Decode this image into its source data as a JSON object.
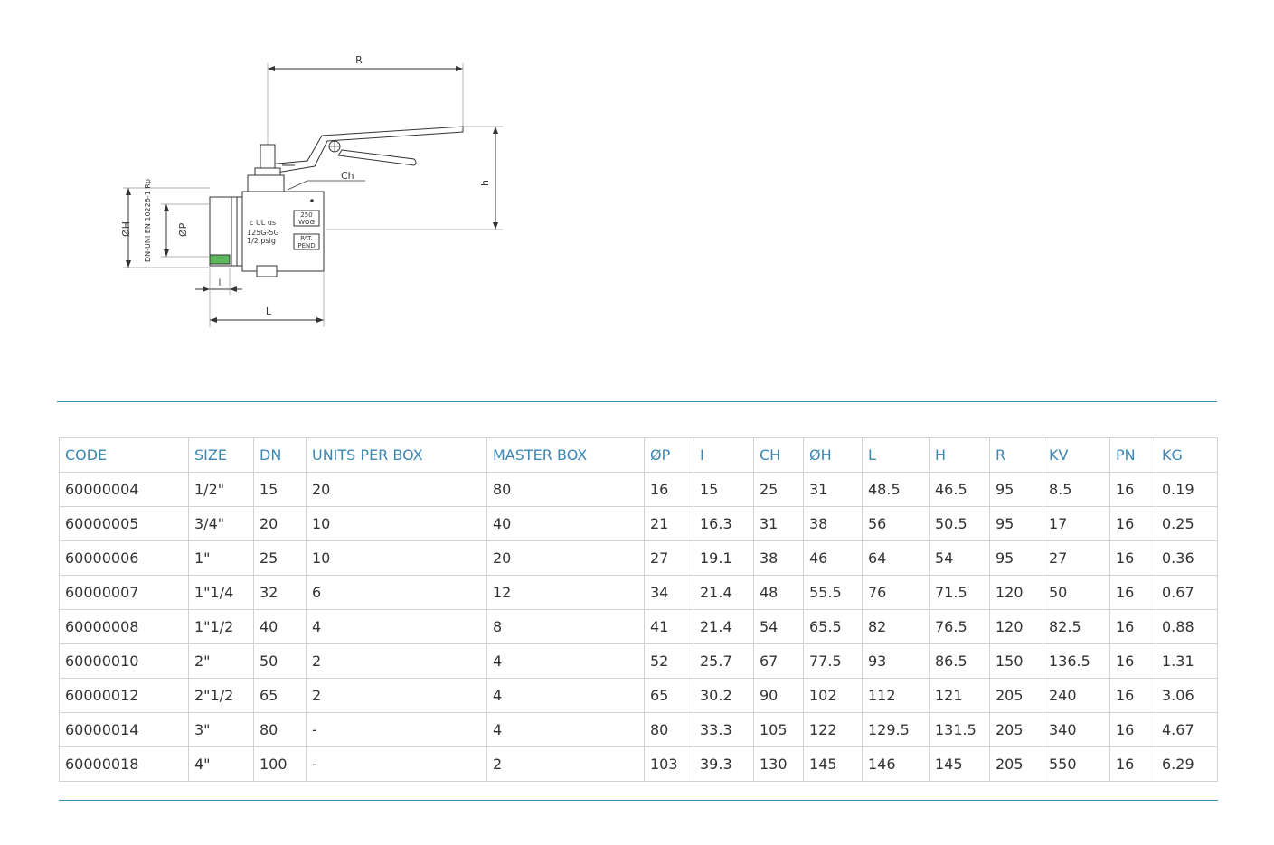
{
  "drawing": {
    "dim_R": "R",
    "dim_h": "h",
    "dim_Ch": "Ch",
    "dim_OH": "ØH",
    "dim_OP": "ØP",
    "dim_l": "l",
    "dim_L": "L",
    "standard_label": "DN-UNI EN 10226-1 Rp",
    "cert_mark": "c UL us",
    "body_text_1": "125G-5G",
    "body_text_2": "1/2 psig",
    "badge_wog_1": "250",
    "badge_wog_2": "WOG",
    "badge_pat_1": "PAT.",
    "badge_pat_2": "PEND"
  },
  "colors": {
    "accent": "#3a87b3",
    "green_ring": "#5cb85c"
  },
  "table": {
    "headers": [
      "CODE",
      "SIZE",
      "DN",
      "UNITS PER BOX",
      "MASTER BOX",
      "ØP",
      "I",
      "CH",
      "ØH",
      "L",
      "H",
      "R",
      "KV",
      "PN",
      "KG"
    ],
    "rows": [
      [
        "60000004",
        "1/2\"",
        "15",
        "20",
        "80",
        "16",
        "15",
        "25",
        "31",
        "48.5",
        "46.5",
        "95",
        "8.5",
        "16",
        "0.19"
      ],
      [
        "60000005",
        "3/4\"",
        "20",
        "10",
        "40",
        "21",
        "16.3",
        "31",
        "38",
        "56",
        "50.5",
        "95",
        "17",
        "16",
        "0.25"
      ],
      [
        "60000006",
        "1\"",
        "25",
        "10",
        "20",
        "27",
        "19.1",
        "38",
        "46",
        "64",
        "54",
        "95",
        "27",
        "16",
        "0.36"
      ],
      [
        "60000007",
        "1\"1/4",
        "32",
        "6",
        "12",
        "34",
        "21.4",
        "48",
        "55.5",
        "76",
        "71.5",
        "120",
        "50",
        "16",
        "0.67"
      ],
      [
        "60000008",
        "1\"1/2",
        "40",
        "4",
        "8",
        "41",
        "21.4",
        "54",
        "65.5",
        "82",
        "76.5",
        "120",
        "82.5",
        "16",
        "0.88"
      ],
      [
        "60000010",
        "2\"",
        "50",
        "2",
        "4",
        "52",
        "25.7",
        "67",
        "77.5",
        "93",
        "86.5",
        "150",
        "136.5",
        "16",
        "1.31"
      ],
      [
        "60000012",
        "2\"1/2",
        "65",
        "2",
        "4",
        "65",
        "30.2",
        "90",
        "102",
        "112",
        "121",
        "205",
        "240",
        "16",
        "3.06"
      ],
      [
        "60000014",
        "3\"",
        "80",
        "-",
        "4",
        "80",
        "33.3",
        "105",
        "122",
        "129.5",
        "131.5",
        "205",
        "340",
        "16",
        "4.67"
      ],
      [
        "60000018",
        "4\"",
        "100",
        "-",
        "2",
        "103",
        "39.3",
        "130",
        "145",
        "146",
        "145",
        "205",
        "550",
        "16",
        "6.29"
      ]
    ]
  }
}
